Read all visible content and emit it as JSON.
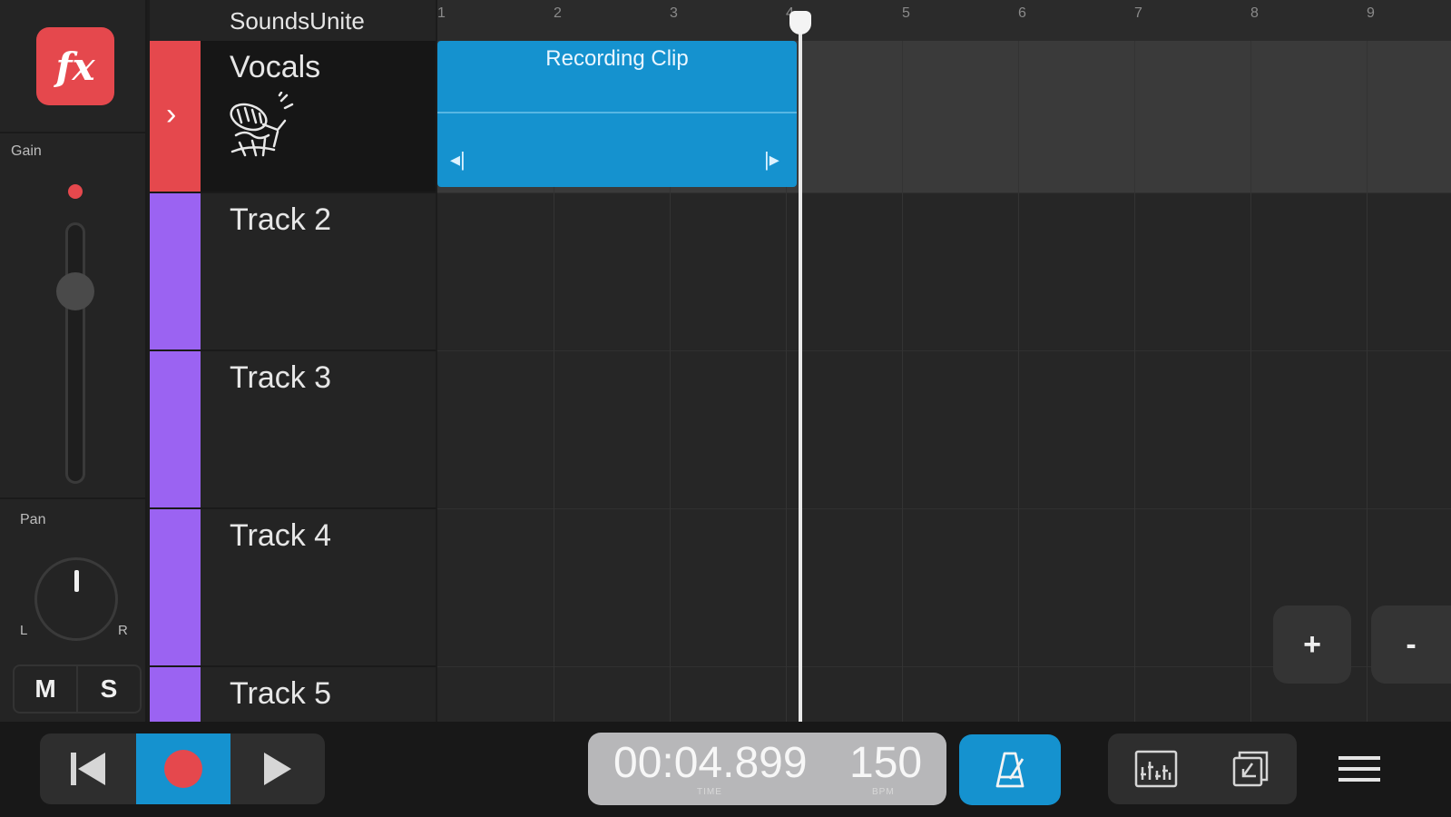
{
  "app": {
    "project_name": "SoundsUnite"
  },
  "mixer": {
    "fx_label": "fx",
    "gain_label": "Gain",
    "gain_level": 0.75,
    "pan_label": "Pan",
    "pan_left": "L",
    "pan_right": "R",
    "mute_label": "M",
    "solo_label": "S"
  },
  "tracks": [
    {
      "name": "Vocals",
      "color": "#e5484d",
      "selected": true,
      "expand_icon": "chevron-right-icon"
    },
    {
      "name": "Track 2",
      "color": "#9b63f2"
    },
    {
      "name": "Track 3",
      "color": "#9b63f2"
    },
    {
      "name": "Track 4",
      "color": "#9b63f2"
    },
    {
      "name": "Track 5",
      "color": "#9b63f2"
    }
  ],
  "timeline": {
    "bar_numbers": [
      "1",
      "2",
      "3",
      "4",
      "5",
      "6",
      "7",
      "8",
      "9"
    ],
    "clip": {
      "title": "Recording Clip",
      "color": "#1592cf",
      "track": "Vocals"
    },
    "zoom_in_label": "+",
    "zoom_out_label": "-"
  },
  "transport": {
    "time": "00:04.899",
    "time_caption": "TIME",
    "bpm": "150",
    "bpm_caption": "BPM",
    "record_color": "#e5484d",
    "accent_color": "#1592cf",
    "icons": [
      "skip-back-icon",
      "record-icon",
      "play-icon",
      "metronome-icon",
      "mixer-view-icon",
      "edit-view-icon",
      "menu-icon"
    ]
  }
}
